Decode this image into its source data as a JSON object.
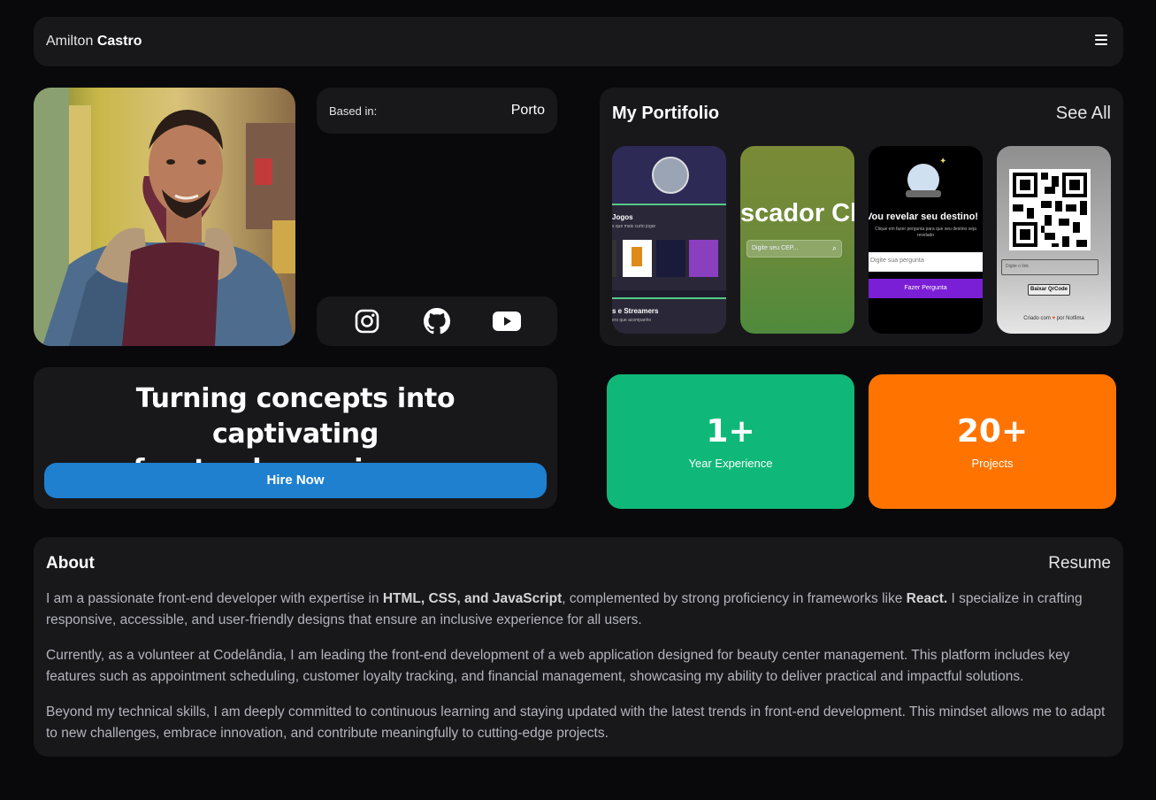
{
  "header": {
    "first_name": "Amilton",
    "last_name": "Castro",
    "menu_icon": "hamburger-icon"
  },
  "based_in": {
    "label": "Based in:",
    "value": "Porto"
  },
  "socials": [
    {
      "name": "instagram-icon"
    },
    {
      "name": "github-icon"
    },
    {
      "name": "youtube-icon"
    }
  ],
  "hero": {
    "headline_line1": "Turning concepts into captivating",
    "headline_line2": "frontend experiences.",
    "button": "Hire Now"
  },
  "portfolio": {
    "title": "My Portifolio",
    "see_all": "See All",
    "thumbs": {
      "t1": {
        "section1": "Jogos",
        "section1_sub": "s que mais curto jogar",
        "section2": "s e Streamers",
        "section2_sub": "ers que acompanho"
      },
      "t2": {
        "title": "scador Cl",
        "input_placeholder": "Digite seu CEP..."
      },
      "t3": {
        "title": "Vou revelar seu destino!",
        "sub": "Clique em fazer pergunta para que seu destino seja revelado",
        "input_placeholder": "Digite sua pergunta",
        "button": "Fazer Pergunta"
      },
      "t4": {
        "input_placeholder": "Digite o link",
        "button": "Baixar QrCode",
        "footer_pre": "Criado com",
        "footer_post": "por Notfima"
      }
    }
  },
  "stats": [
    {
      "value": "1+",
      "label": "Year Experience",
      "color": "#0fb878"
    },
    {
      "value": "20+",
      "label": "Projects",
      "color": "#ff7400"
    }
  ],
  "about": {
    "title": "About",
    "resume": "Resume",
    "p1_a": "I am a passionate front-end developer with expertise in ",
    "p1_b": "HTML, CSS, and JavaScript",
    "p1_c": ", complemented by strong proficiency in frameworks like ",
    "p1_d": "React.",
    "p1_e": " I specialize in crafting responsive, accessible, and user-friendly designs that ensure an inclusive experience for all users.",
    "p2": "Currently, as a volunteer at Codelândia, I am leading the front-end development of a web application designed for beauty center management. This platform includes key features such as appointment scheduling, customer loyalty tracking, and financial management, showcasing my ability to deliver practical and impactful solutions.",
    "p3": "Beyond my technical skills, I am deeply committed to continuous learning and staying updated with the latest trends in front-end development. This mindset allows me to adapt to new challenges, embrace innovation, and contribute meaningfully to cutting-edge projects."
  },
  "colors": {
    "background": "#09090b",
    "card": "#18181b",
    "accent_blue": "#1f80d0"
  }
}
